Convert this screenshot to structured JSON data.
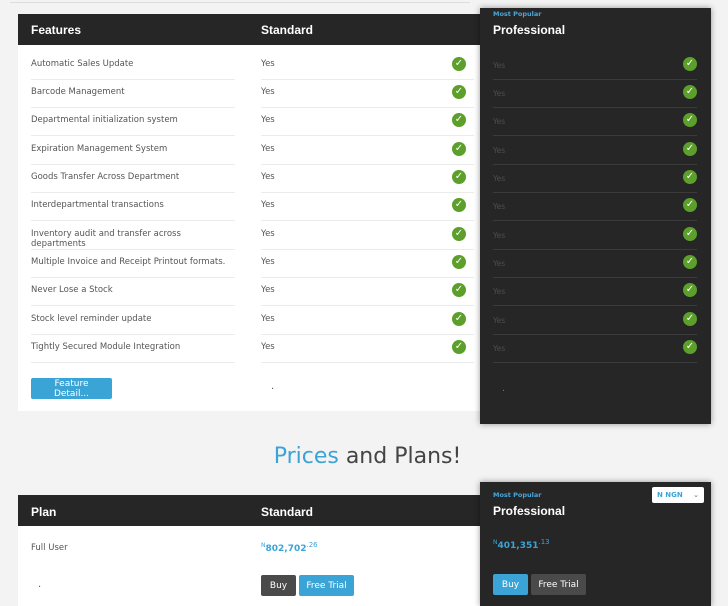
{
  "features_header": {
    "col1": "Features",
    "col2": "Standard"
  },
  "features": [
    {
      "name": "Automatic Sales Update",
      "standard": "Yes",
      "professional": "Yes"
    },
    {
      "name": "Barcode Management",
      "standard": "Yes",
      "professional": "Yes"
    },
    {
      "name": "Departmental initialization system",
      "standard": "Yes",
      "professional": "Yes"
    },
    {
      "name": "Expiration Management System",
      "standard": "Yes",
      "professional": "Yes"
    },
    {
      "name": "Goods Transfer Across Department",
      "standard": "Yes",
      "professional": "Yes"
    },
    {
      "name": "Interdepartmental transactions",
      "standard": "Yes",
      "professional": "Yes"
    },
    {
      "name": "Inventory audit and transfer across departments",
      "standard": "Yes",
      "professional": "Yes"
    },
    {
      "name": "Multiple Invoice and Receipt Printout formats.",
      "standard": "Yes",
      "professional": "Yes"
    },
    {
      "name": "Never Lose a Stock",
      "standard": "Yes",
      "professional": "Yes"
    },
    {
      "name": "Stock level reminder update",
      "standard": "Yes",
      "professional": "Yes"
    },
    {
      "name": "Tightly Secured Module Integration",
      "standard": "Yes",
      "professional": "Yes"
    }
  ],
  "feature_detail_button": "Feature Detail...",
  "standard_footer_dot": ".",
  "professional": {
    "badge": "Most Popular",
    "title": "Professional",
    "footer_dot": "."
  },
  "prices_heading": {
    "accent": "Prices",
    "rest": " and Plans!"
  },
  "plan_header": {
    "col1": "Plan",
    "col2": "Standard"
  },
  "plan_row_label": "Full User",
  "plan_row2_dot": ".",
  "standard_price": {
    "currency": "N",
    "amount": "802,702",
    "cents": ".26"
  },
  "professional_price": {
    "currency": "N",
    "amount": "401,351",
    "cents": ".13"
  },
  "buy_label": "Buy",
  "free_trial_label": "Free Trial",
  "currency_select": "N NGN",
  "colors": {
    "accent": "#3ba4d6",
    "dark": "#262626",
    "check": "#5c9f2a"
  },
  "icons": {
    "check": "check-circle-icon",
    "dropdown": "chevron-down-icon"
  }
}
